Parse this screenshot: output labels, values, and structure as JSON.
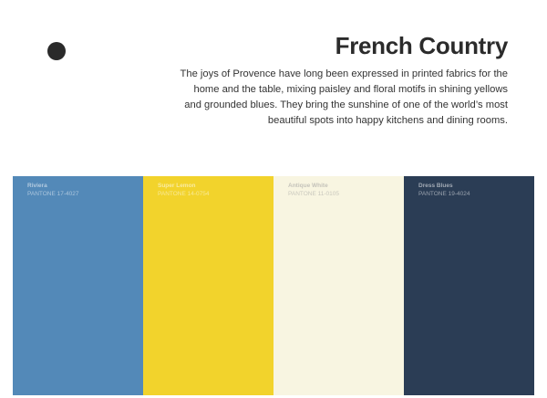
{
  "header": {
    "title": "French Country",
    "description": "The joys of Provence have long been expressed in printed fabrics for the home and the table, mixing paisley and floral motifs in shining yellows and grounded blues. They bring the sunshine of one of the world’s most beautiful spots into happy kitchens and dining rooms."
  },
  "palette": {
    "swatches": [
      {
        "name": "Riviera",
        "code": "PANTONE 17-4027",
        "color": "#5389b8",
        "text_color": "#ffffff"
      },
      {
        "name": "Super Lemon",
        "code": "PANTONE 14-0754",
        "color": "#f2d32c",
        "text_color": "#ffffff"
      },
      {
        "name": "Antique White",
        "code": "PANTONE 11-0105",
        "color": "#f8f5e1",
        "text_color": "#9a9a9a"
      },
      {
        "name": "Dress Blues",
        "code": "PANTONE 19-4024",
        "color": "#2b3d55",
        "text_color": "#ffffff"
      }
    ]
  },
  "colors": {
    "bullet": "#2a2a2a",
    "text": "#2b2b2b"
  }
}
